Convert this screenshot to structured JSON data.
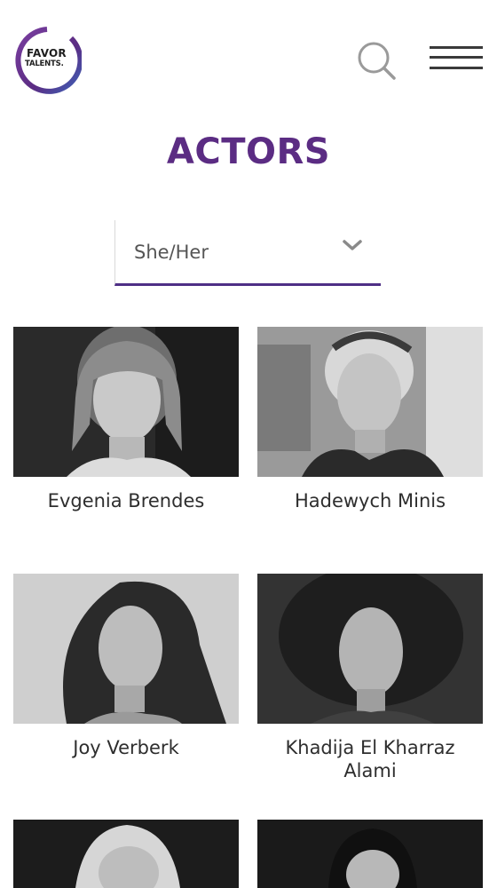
{
  "header": {
    "logo": {
      "line1": "FAVOR",
      "line2": "TALENTS.",
      "ring_color": "#5b2c83"
    },
    "search_icon": "search-icon",
    "menu_icon": "hamburger-menu-icon"
  },
  "page": {
    "title": "ACTORS",
    "title_color": "#5b2c83"
  },
  "filter": {
    "selected": "She/Her",
    "accent": "#4f2f86",
    "icon": "chevron-down-icon"
  },
  "actors": [
    {
      "name": "Evgenia Brendes"
    },
    {
      "name": "Hadewych Minis"
    },
    {
      "name": "Joy Verberk"
    },
    {
      "name": "Khadija El Kharraz Alami"
    },
    {
      "name": ""
    },
    {
      "name": ""
    }
  ]
}
